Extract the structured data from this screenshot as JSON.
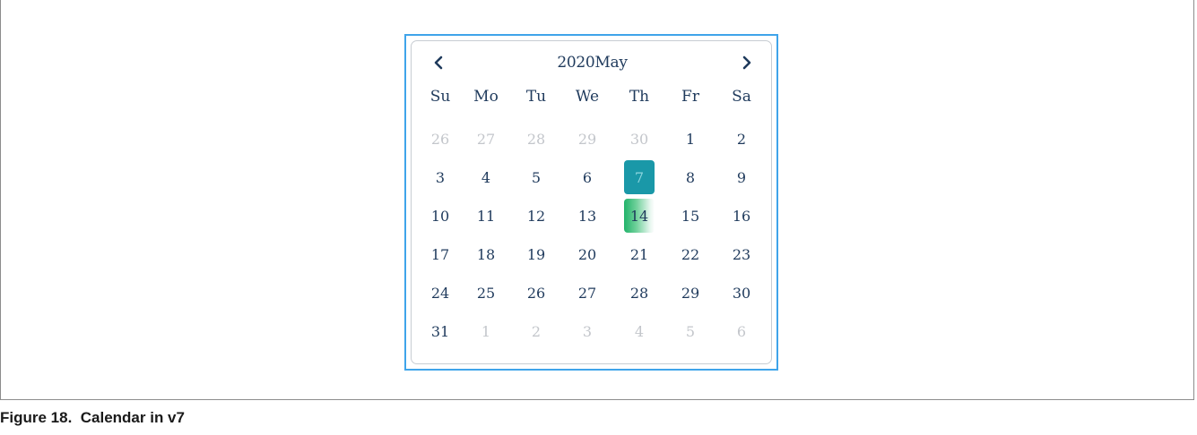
{
  "calendar": {
    "title": "2020May",
    "prev_icon": "chevron-left-icon",
    "next_icon": "chevron-right-icon",
    "weekdays": [
      "Su",
      "Mo",
      "Tu",
      "We",
      "Th",
      "Fr",
      "Sa"
    ],
    "weeks": [
      [
        {
          "d": "26",
          "m": true
        },
        {
          "d": "27",
          "m": true
        },
        {
          "d": "28",
          "m": true
        },
        {
          "d": "29",
          "m": true
        },
        {
          "d": "30",
          "m": true
        },
        {
          "d": "1"
        },
        {
          "d": "2"
        }
      ],
      [
        {
          "d": "3"
        },
        {
          "d": "4"
        },
        {
          "d": "5"
        },
        {
          "d": "6"
        },
        {
          "d": "7",
          "selected": true
        },
        {
          "d": "8"
        },
        {
          "d": "9"
        }
      ],
      [
        {
          "d": "10"
        },
        {
          "d": "11"
        },
        {
          "d": "12"
        },
        {
          "d": "13"
        },
        {
          "d": "14",
          "today": true
        },
        {
          "d": "15"
        },
        {
          "d": "16"
        }
      ],
      [
        {
          "d": "17"
        },
        {
          "d": "18"
        },
        {
          "d": "19"
        },
        {
          "d": "20"
        },
        {
          "d": "21"
        },
        {
          "d": "22"
        },
        {
          "d": "23"
        }
      ],
      [
        {
          "d": "24"
        },
        {
          "d": "25"
        },
        {
          "d": "26"
        },
        {
          "d": "27"
        },
        {
          "d": "28"
        },
        {
          "d": "29"
        },
        {
          "d": "30"
        }
      ],
      [
        {
          "d": "31"
        },
        {
          "d": "1",
          "m": true
        },
        {
          "d": "2",
          "m": true
        },
        {
          "d": "3",
          "m": true
        },
        {
          "d": "4",
          "m": true
        },
        {
          "d": "5",
          "m": true
        },
        {
          "d": "6",
          "m": true
        }
      ]
    ],
    "colors": {
      "frame_border": "#3fa4ea",
      "text": "#1f3a5c",
      "muted_text": "#c3c6cb",
      "selected_bg": "#1a98a8",
      "today_gradient_start": "#21b36a"
    }
  },
  "caption": "Figure 18.  Calendar in v7"
}
